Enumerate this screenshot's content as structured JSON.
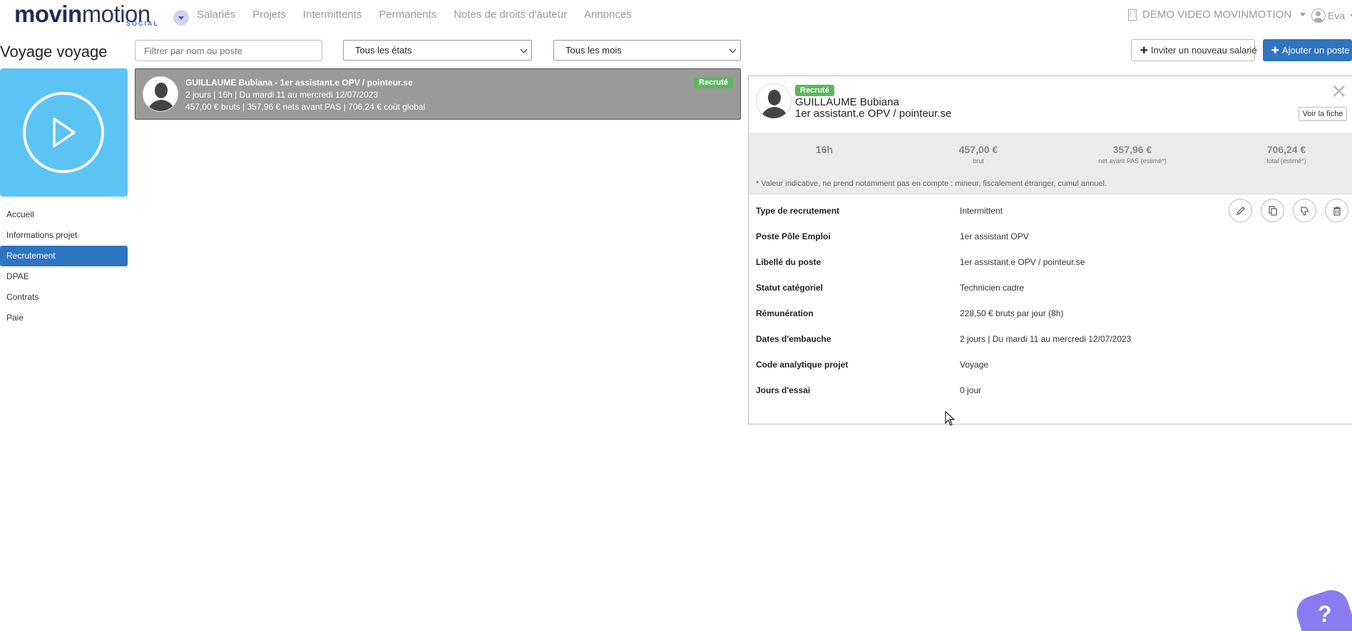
{
  "brand": {
    "word_bold": "movin",
    "word_thin": "motion",
    "social": "SOCIAL"
  },
  "nav": {
    "items": [
      "Salariés",
      "Projets",
      "Intermittents",
      "Permanents",
      "Notes de droits d'auteur",
      "Annonces"
    ]
  },
  "company": {
    "name": "DEMO VIDEO MOVINMOTION"
  },
  "user": {
    "name": "Eva"
  },
  "project": {
    "title": "Voyage voyage"
  },
  "sidebar": {
    "items": [
      {
        "label": "Accueil",
        "active": false
      },
      {
        "label": "Informations projet",
        "active": false
      },
      {
        "label": "Recrutement",
        "active": true
      },
      {
        "label": "DPAE",
        "active": false
      },
      {
        "label": "Contrats",
        "active": false
      },
      {
        "label": "Paie",
        "active": false
      }
    ]
  },
  "filters": {
    "search_placeholder": "Filtrer par nom ou poste",
    "state_selected": "Tous les états",
    "month_selected": "Tous les mois"
  },
  "actions": {
    "invite_label": "Inviter un nouveau salarié",
    "add_label": "Ajouter un poste"
  },
  "card": {
    "title": "GUILLAUME Bubiana - 1er assistant.e OPV / pointeur.se",
    "line2": "2 jours | 16h | Du mardi 11 au mercredi 12/07/2023",
    "line3": "457,00 € bruts | 357,96 € nets avant PAS | 706,24 € coût global",
    "status": "Recruté"
  },
  "detail": {
    "status": "Recruté",
    "name": "GUILLAUME Bubiana",
    "role": "1er assistant.e OPV / pointeur.se",
    "view_label": "Voir la fiche",
    "stats": [
      {
        "value": "16h",
        "sub": ""
      },
      {
        "value": "457,00 €",
        "sub": "brut"
      },
      {
        "value": "357,96 €",
        "sub": "net avant PAS (estimé*)"
      },
      {
        "value": "706,24 €",
        "sub": "total (estimé*)"
      }
    ],
    "note": "* Valeur indicative, ne prend notamment pas en compte : mineur, fiscalement étranger, cumul annuel.",
    "fields": [
      {
        "label": "Type de recrutement",
        "value": "Intermittent"
      },
      {
        "label": "Poste Pôle Emploi",
        "value": "1er assistant OPV"
      },
      {
        "label": "Libellé du poste",
        "value": "1er assistant.e OPV / pointeur.se"
      },
      {
        "label": "Statut catégoriel",
        "value": "Technicien cadre"
      },
      {
        "label": "Rémunération",
        "value": "228,50 € bruts par jour (8h)"
      },
      {
        "label": "Dates d'embauche",
        "value": "2 jours | Du mardi 11 au mercredi 12/07/2023"
      },
      {
        "label": "Code analytique projet",
        "value": "Voyage"
      },
      {
        "label": "Jours d'essai",
        "value": "0 jour"
      }
    ]
  },
  "help": {
    "label": "?"
  },
  "colors": {
    "primary": "#2f74bf",
    "tile": "#5bc4f5",
    "badge": "#5cb85c",
    "help": "#8a7bf0"
  }
}
